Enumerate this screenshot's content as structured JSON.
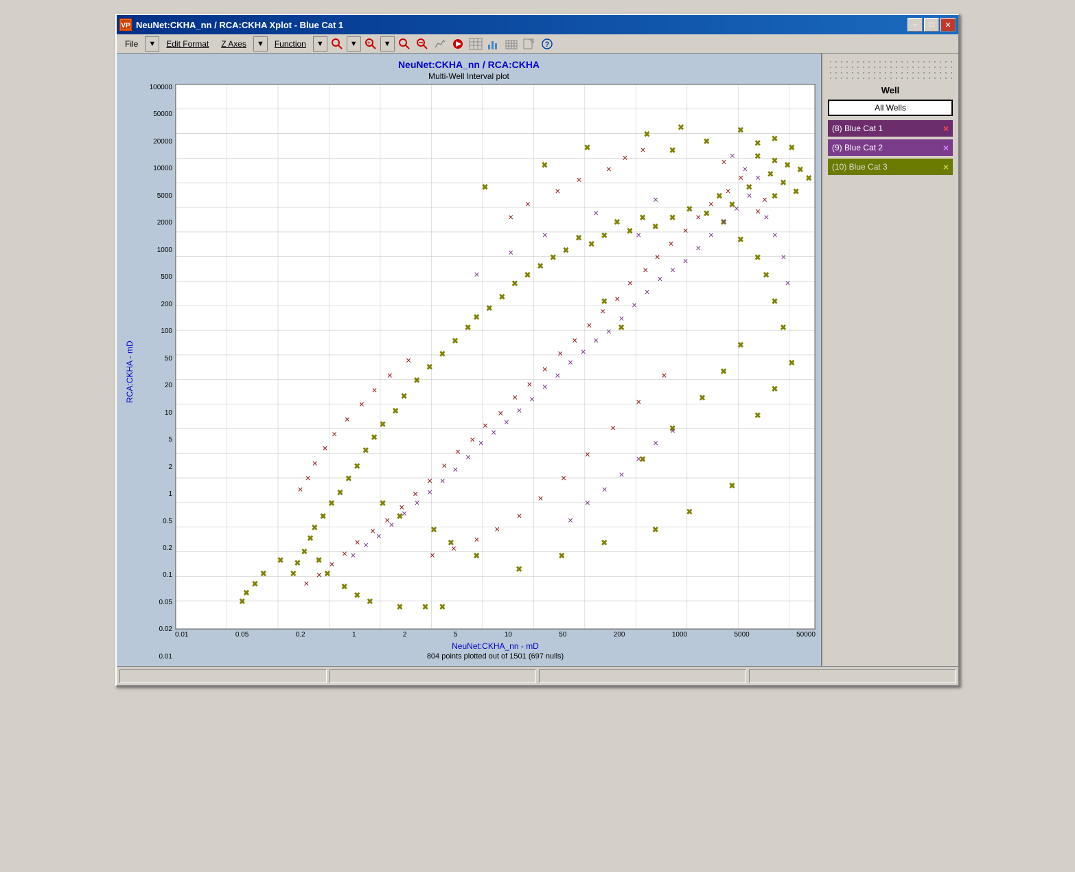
{
  "window": {
    "title": "NeuNet:CKHA_nn / RCA:CKHA Xplot  -  Blue Cat 1",
    "icon": "VP"
  },
  "titleButtons": {
    "minimize": "–",
    "maximize": "□",
    "close": "✕"
  },
  "menu": {
    "file": "File",
    "editFormat": "Edit Format",
    "zAxes": "Z Axes",
    "function": "Function"
  },
  "chart": {
    "title": "NeuNet:CKHA_nn / RCA:CKHA",
    "subtitle": "Multi-Well Interval plot",
    "yAxisLabel": "RCA:CKHA - mD",
    "xAxisLabel": "NeuNet:CKHA_nn - mD",
    "note": "804 points plotted out of 1501 (697 nulls)",
    "yTicks": [
      "100000",
      "50000",
      "20000",
      "10000",
      "5000",
      "2000",
      "1000",
      "500",
      "200",
      "100",
      "50",
      "20",
      "10",
      "5",
      "2",
      "1",
      "0.5",
      "0.2",
      "0.1",
      "0.05",
      "0.02",
      "0.01"
    ],
    "xTicks": [
      "0.01",
      "0.05",
      "0.2",
      "1",
      "2",
      "5",
      "10",
      "50",
      "200",
      "1000",
      "5000",
      "50000"
    ]
  },
  "sidebar": {
    "wellHeader": "Well",
    "allWells": "All Wells",
    "wells": [
      {
        "label": "(8) Blue Cat 1",
        "class": "well-1",
        "xClass": "red"
      },
      {
        "label": "(9) Blue Cat 2",
        "class": "well-2",
        "xClass": "purple"
      },
      {
        "label": "(10) Blue Cat 3",
        "class": "well-3",
        "xClass": "olive"
      }
    ]
  },
  "statusBar": {
    "sections": [
      "",
      "",
      "",
      ""
    ]
  }
}
